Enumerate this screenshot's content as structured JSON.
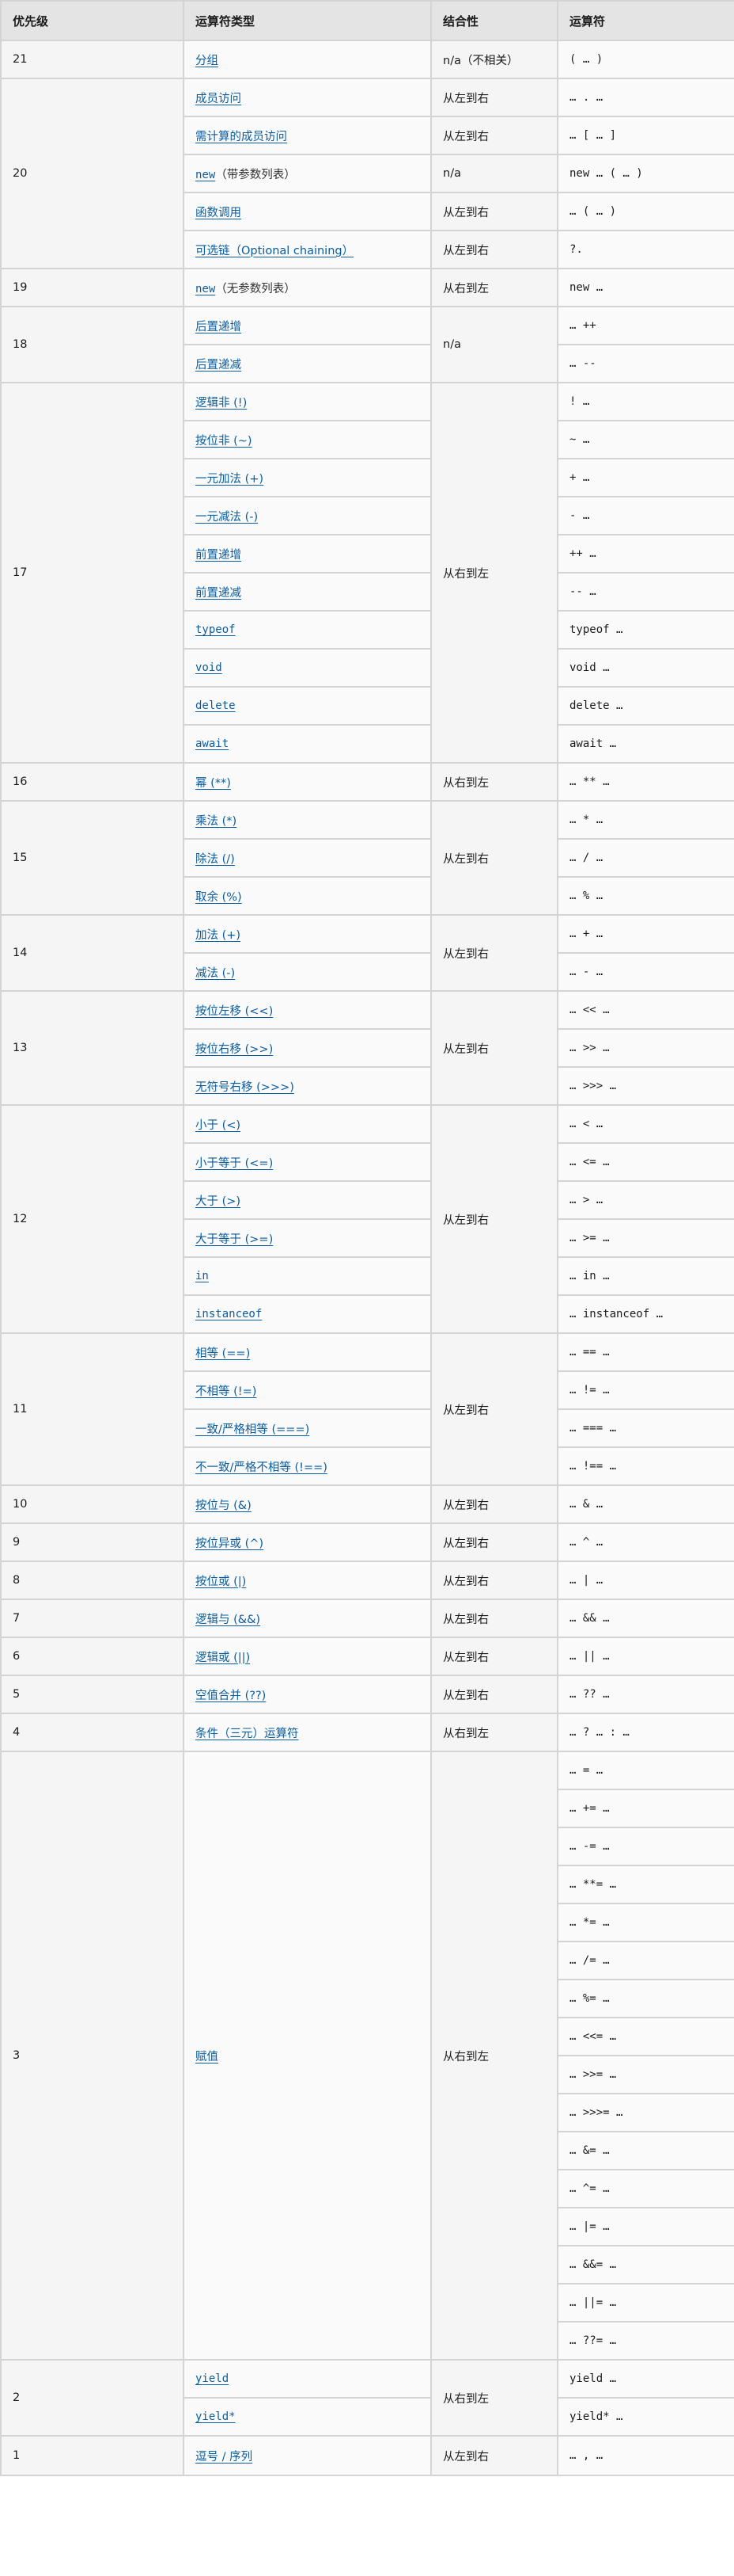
{
  "headers": [
    "优先级",
    "运算符类型",
    "结合性",
    "运算符"
  ],
  "colors": {
    "link": "#0b5da0",
    "header_bg": "#e4e4e4",
    "border": "#d4d4d4"
  },
  "groups": [
    {
      "precedence": "21",
      "rows": [
        {
          "type": "分组",
          "code": false,
          "note": "",
          "assoc": "n/a（不相关）",
          "op": "( … )"
        }
      ]
    },
    {
      "precedence": "20",
      "rows": [
        {
          "type": "成员访问",
          "code": false,
          "note": "",
          "assoc": "从左到右",
          "op": "… . …"
        },
        {
          "type": "需计算的成员访问",
          "code": false,
          "note": "",
          "assoc": "从左到右",
          "op": "… [ … ]"
        },
        {
          "type": "new",
          "code": true,
          "note": "（带参数列表）",
          "assoc": "n/a",
          "op": "new … ( … )"
        },
        {
          "type": "函数调用",
          "code": false,
          "note": "",
          "assoc": "从左到右",
          "op": "… ( … )"
        },
        {
          "type": "可选链（Optional chaining）",
          "code": false,
          "note": "",
          "assoc": "从左到右",
          "op": "?."
        }
      ]
    },
    {
      "precedence": "19",
      "rows": [
        {
          "type": "new",
          "code": true,
          "note": "（无参数列表）",
          "assoc": "从右到左",
          "op": "new …"
        }
      ]
    },
    {
      "precedence": "18",
      "assoc": "n/a",
      "rows": [
        {
          "type": "后置递增",
          "code": false,
          "note": "",
          "op": "… ++"
        },
        {
          "type": "后置递减",
          "code": false,
          "note": "",
          "op": "… --"
        }
      ]
    },
    {
      "precedence": "17",
      "assoc": "从右到左",
      "rows": [
        {
          "type": "逻辑非 (!)",
          "code": false,
          "note": "",
          "op": "! …"
        },
        {
          "type": "按位非 (~)",
          "code": false,
          "note": "",
          "op": "~ …"
        },
        {
          "type": "一元加法 (+)",
          "code": false,
          "note": "",
          "op": "+ …"
        },
        {
          "type": "一元减法 (-)",
          "code": false,
          "note": "",
          "op": "- …"
        },
        {
          "type": "前置递增",
          "code": false,
          "note": "",
          "op": "++ …"
        },
        {
          "type": "前置递减",
          "code": false,
          "note": "",
          "op": "-- …"
        },
        {
          "type": "typeof",
          "code": true,
          "note": "",
          "op": "typeof …"
        },
        {
          "type": "void",
          "code": true,
          "note": "",
          "op": "void …"
        },
        {
          "type": "delete",
          "code": true,
          "note": "",
          "op": "delete …"
        },
        {
          "type": "await",
          "code": true,
          "note": "",
          "op": "await …"
        }
      ]
    },
    {
      "precedence": "16",
      "rows": [
        {
          "type": "幂 (**)",
          "code": false,
          "note": "",
          "assoc": "从右到左",
          "op": "… ** …"
        }
      ]
    },
    {
      "precedence": "15",
      "assoc": "从左到右",
      "rows": [
        {
          "type": "乘法 (*)",
          "code": false,
          "note": "",
          "op": "… * …"
        },
        {
          "type": "除法 (/)",
          "code": false,
          "note": "",
          "op": "… / …"
        },
        {
          "type": "取余 (%)",
          "code": false,
          "note": "",
          "op": "… % …"
        }
      ]
    },
    {
      "precedence": "14",
      "assoc": "从左到右",
      "rows": [
        {
          "type": "加法 (+)",
          "code": false,
          "note": "",
          "op": "… + …"
        },
        {
          "type": "减法 (-)",
          "code": false,
          "note": "",
          "op": "… - …"
        }
      ]
    },
    {
      "precedence": "13",
      "assoc": "从左到右",
      "rows": [
        {
          "type": "按位左移 (<<)",
          "code": false,
          "note": "",
          "op": "… << …"
        },
        {
          "type": "按位右移 (>>)",
          "code": false,
          "note": "",
          "op": "… >> …"
        },
        {
          "type": "无符号右移 (>>>)",
          "code": false,
          "note": "",
          "op": "… >>> …"
        }
      ]
    },
    {
      "precedence": "12",
      "assoc": "从左到右",
      "rows": [
        {
          "type": "小于 (<)",
          "code": false,
          "note": "",
          "op": "… < …"
        },
        {
          "type": "小于等于 (<=)",
          "code": false,
          "note": "",
          "op": "… <= …"
        },
        {
          "type": "大于 (>)",
          "code": false,
          "note": "",
          "op": "… > …"
        },
        {
          "type": "大于等于 (>=)",
          "code": false,
          "note": "",
          "op": "… >= …"
        },
        {
          "type": "in",
          "code": true,
          "note": "",
          "op": "… in …"
        },
        {
          "type": "instanceof",
          "code": true,
          "note": "",
          "op": "… instanceof …"
        }
      ]
    },
    {
      "precedence": "11",
      "assoc": "从左到右",
      "rows": [
        {
          "type": "相等 (==)",
          "code": false,
          "note": "",
          "op": "… == …"
        },
        {
          "type": "不相等 (!=)",
          "code": false,
          "note": "",
          "op": "… != …"
        },
        {
          "type": "一致/严格相等 (===)",
          "code": false,
          "note": "",
          "op": "… === …"
        },
        {
          "type": "不一致/严格不相等 (!==)",
          "code": false,
          "note": "",
          "op": "… !== …"
        }
      ]
    },
    {
      "precedence": "10",
      "rows": [
        {
          "type": "按位与 (&)",
          "code": false,
          "note": "",
          "assoc": "从左到右",
          "op": "… & …"
        }
      ]
    },
    {
      "precedence": "9",
      "rows": [
        {
          "type": "按位异或 (^)",
          "code": false,
          "note": "",
          "assoc": "从左到右",
          "op": "… ^ …"
        }
      ]
    },
    {
      "precedence": "8",
      "rows": [
        {
          "type": "按位或 (|)",
          "code": false,
          "note": "",
          "assoc": "从左到右",
          "op": "… | …"
        }
      ]
    },
    {
      "precedence": "7",
      "rows": [
        {
          "type": "逻辑与 (&&)",
          "code": false,
          "note": "",
          "assoc": "从左到右",
          "op": "… && …"
        }
      ]
    },
    {
      "precedence": "6",
      "rows": [
        {
          "type": "逻辑或 (||)",
          "code": false,
          "note": "",
          "assoc": "从左到右",
          "op": "… || …"
        }
      ]
    },
    {
      "precedence": "5",
      "rows": [
        {
          "type": "空值合并 (??)",
          "code": false,
          "note": "",
          "assoc": "从左到右",
          "op": "… ?? …"
        }
      ]
    },
    {
      "precedence": "4",
      "rows": [
        {
          "type": "条件（三元）运算符",
          "code": false,
          "note": "",
          "assoc": "从右到左",
          "op": "… ? … : …"
        }
      ]
    },
    {
      "precedence": "3",
      "type": "赋值",
      "assoc": "从右到左",
      "rows": [
        {
          "op": "… = …"
        },
        {
          "op": "… += …"
        },
        {
          "op": "… -= …"
        },
        {
          "op": "… **= …"
        },
        {
          "op": "… *= …"
        },
        {
          "op": "… /= …"
        },
        {
          "op": "… %= …"
        },
        {
          "op": "… <<= …"
        },
        {
          "op": "… >>= …"
        },
        {
          "op": "… >>>= …"
        },
        {
          "op": "… &= …"
        },
        {
          "op": "… ^= …"
        },
        {
          "op": "… |= …"
        },
        {
          "op": "… &&= …"
        },
        {
          "op": "… ||= …"
        },
        {
          "op": "… ??= …"
        }
      ]
    },
    {
      "precedence": "2",
      "assoc": "从右到左",
      "rows": [
        {
          "type": "yield",
          "code": true,
          "note": "",
          "op": "yield …"
        },
        {
          "type": "yield*",
          "code": true,
          "note": "",
          "op": "yield* …"
        }
      ]
    },
    {
      "precedence": "1",
      "rows": [
        {
          "type": "逗号 / 序列",
          "code": false,
          "note": "",
          "assoc": "从左到右",
          "op": "… , …"
        }
      ]
    }
  ]
}
